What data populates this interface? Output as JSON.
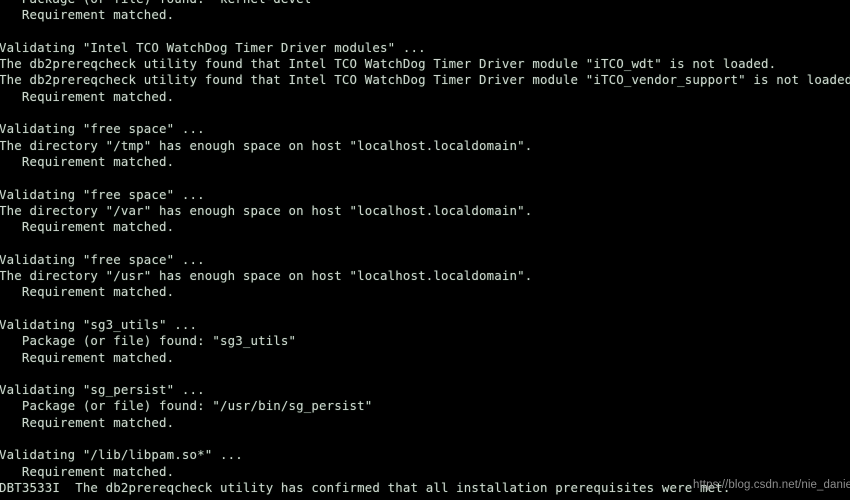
{
  "terminal": {
    "background_color": "#000000",
    "text_color": "#cfd6cf",
    "lines": [
      "   Package (or file) found: \"kernel-devel\"",
      "   Requirement matched.",
      "",
      "Validating \"Intel TCO WatchDog Timer Driver modules\" ...",
      "The db2prereqcheck utility found that Intel TCO WatchDog Timer Driver module \"iTCO_wdt\" is not loaded.",
      "The db2prereqcheck utility found that Intel TCO WatchDog Timer Driver module \"iTCO_vendor_support\" is not loaded.",
      "   Requirement matched.",
      "",
      "Validating \"free space\" ...",
      "The directory \"/tmp\" has enough space on host \"localhost.localdomain\".",
      "   Requirement matched.",
      "",
      "Validating \"free space\" ...",
      "The directory \"/var\" has enough space on host \"localhost.localdomain\".",
      "   Requirement matched.",
      "",
      "Validating \"free space\" ...",
      "The directory \"/usr\" has enough space on host \"localhost.localdomain\".",
      "   Requirement matched.",
      "",
      "Validating \"sg3_utils\" ...",
      "   Package (or file) found: \"sg3_utils\"",
      "   Requirement matched.",
      "",
      "Validating \"sg_persist\" ...",
      "   Package (or file) found: \"/usr/bin/sg_persist\"",
      "   Requirement matched.",
      "",
      "Validating \"/lib/libpam.so*\" ...",
      "   Requirement matched.",
      "DBT3533I  The db2prereqcheck utility has confirmed that all installation prerequisites were met."
    ]
  },
  "watermark": {
    "text": "https://blog.csdn.net/nie_daniel",
    "color": "#9a9a9a"
  }
}
